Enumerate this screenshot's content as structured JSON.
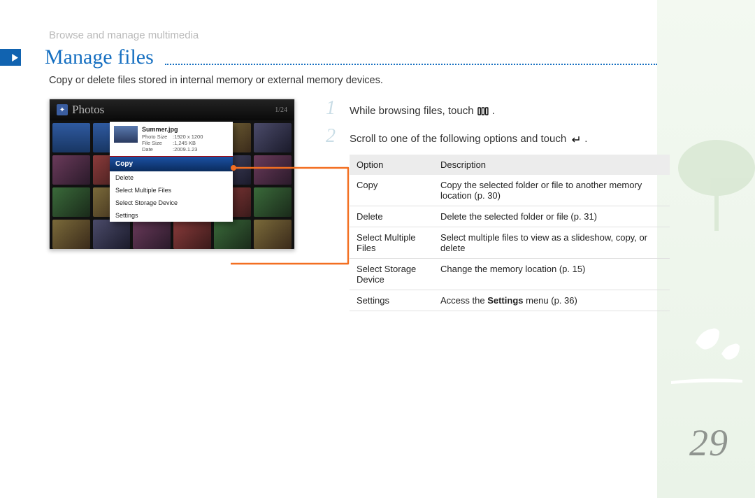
{
  "breadcrumb": "Browse and manage multimedia",
  "title": "Manage files",
  "intro": "Copy or delete files stored in internal memory or external memory devices.",
  "screenshot": {
    "header_title": "Photos",
    "counter": "1/24",
    "popup": {
      "filename": "Summer.jpg",
      "photo_size_label": "Photo Size",
      "photo_size": "1920 x 1200",
      "file_size_label": "File Size",
      "file_size": "1,245 KB",
      "date_label": "Date",
      "date": "2009.1.23",
      "items": {
        "copy": "Copy",
        "delete": "Delete",
        "select_multiple": "Select Multiple Files",
        "select_storage": "Select Storage Device",
        "settings": "Settings"
      }
    }
  },
  "steps": {
    "s1": "While browsing files, touch",
    "s1_tail": ".",
    "s2": "Scroll to one of the following options and touch",
    "s2_tail": "."
  },
  "table": {
    "h1": "Option",
    "h2": "Description",
    "rows": [
      {
        "opt": "Copy",
        "desc": "Copy the selected folder or file to another memory location (p. 30)"
      },
      {
        "opt": "Delete",
        "desc": "Delete the selected folder or file (p. 31)"
      },
      {
        "opt": "Select Multiple Files",
        "desc": "Select multiple files to view as a slideshow, copy, or delete"
      },
      {
        "opt": "Select Storage Device",
        "desc": "Change the memory location (p. 15)"
      },
      {
        "opt": "Settings",
        "desc_pre": "Access the ",
        "desc_strong": "Settings",
        "desc_post": " menu (p. 36)"
      }
    ]
  },
  "page_number": "29"
}
